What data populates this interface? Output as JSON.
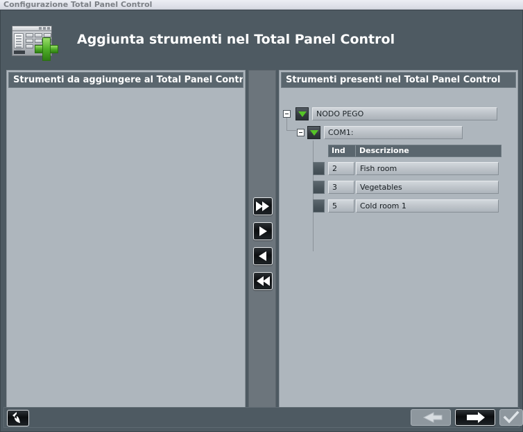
{
  "window": {
    "titlebar": "Configurazione Total Panel Control",
    "header_title": "Aggiunta strumenti nel Total Panel Control",
    "header_icon": "panel-add-icon"
  },
  "colors": {
    "window_bg": "#4e5a62",
    "panel_bg": "#aeb6bd",
    "panel_header_bg": "#5a666e",
    "accent_green": "#56c427",
    "titlebar_bg": "#e4e6ee",
    "titlebar_text": "#7c8086"
  },
  "left_panel": {
    "title": "Strumenti da aggiungere al Total Panel Control",
    "items": []
  },
  "right_panel": {
    "title": "Strumenti presenti nel Total Panel Control",
    "tree": {
      "node_label": "NODO PEGO",
      "node_expander": "-",
      "port_label": "COM1:",
      "port_expander": "-"
    },
    "grid": {
      "columns": [
        "Ind",
        "Descrizione"
      ],
      "rows": [
        {
          "ind": "2",
          "descrizione": "Fish room"
        },
        {
          "ind": "3",
          "descrizione": "Vegetables"
        },
        {
          "ind": "5",
          "descrizione": "Cold room 1"
        }
      ]
    }
  },
  "transfer_buttons": [
    {
      "name": "move-all-right-button",
      "icon": "double-right-arrow-icon"
    },
    {
      "name": "move-right-button",
      "icon": "right-arrow-icon"
    },
    {
      "name": "move-left-button",
      "icon": "left-arrow-icon"
    },
    {
      "name": "move-all-left-button",
      "icon": "double-left-arrow-icon"
    }
  ],
  "bottom_bar": {
    "back_button": {
      "name": "undo-back-button",
      "icon": "curved-back-arrow-icon",
      "enabled": true
    },
    "prev_button": {
      "name": "wizard-prev-button",
      "icon": "left-arrow-icon",
      "enabled": false
    },
    "next_button": {
      "name": "wizard-next-button",
      "icon": "right-arrow-icon",
      "enabled": true
    },
    "confirm_button": {
      "name": "wizard-confirm-button",
      "icon": "checkmark-icon",
      "enabled": false
    }
  }
}
